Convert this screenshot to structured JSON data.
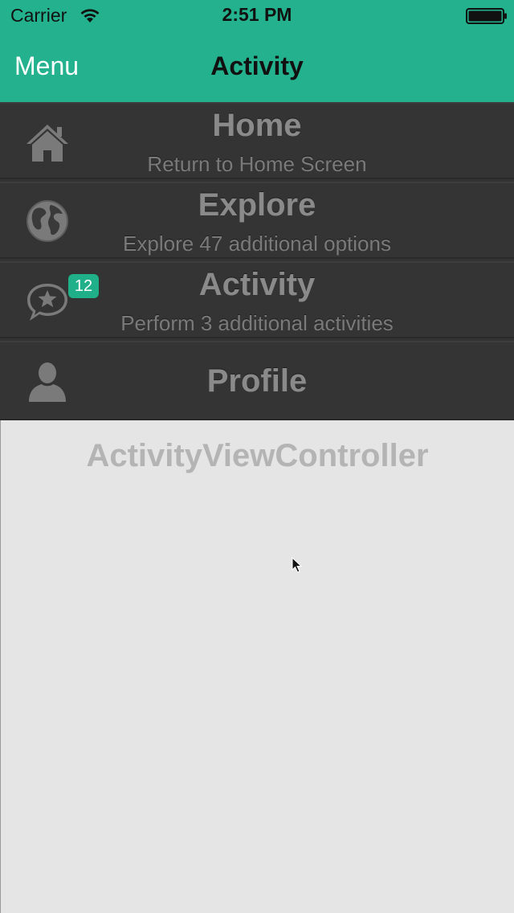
{
  "status_bar": {
    "carrier": "Carrier",
    "time": "2:51 PM"
  },
  "nav": {
    "menu_label": "Menu",
    "title": "Activity"
  },
  "menu": {
    "items": [
      {
        "title": "Home",
        "subtitle": "Return to Home Screen",
        "icon": "home-icon"
      },
      {
        "title": "Explore",
        "subtitle": "Explore 47 additional options",
        "icon": "globe-icon"
      },
      {
        "title": "Activity",
        "subtitle": "Perform 3 additional activities",
        "icon": "chat-star-icon",
        "badge": "12"
      },
      {
        "title": "Profile",
        "subtitle": "",
        "icon": "person-icon"
      }
    ]
  },
  "content": {
    "label": "ActivityViewController"
  },
  "colors": {
    "accent": "#24b28e",
    "menu_background": "#343434",
    "badge": "#1fb08a",
    "content_background": "#e5e5e5"
  }
}
